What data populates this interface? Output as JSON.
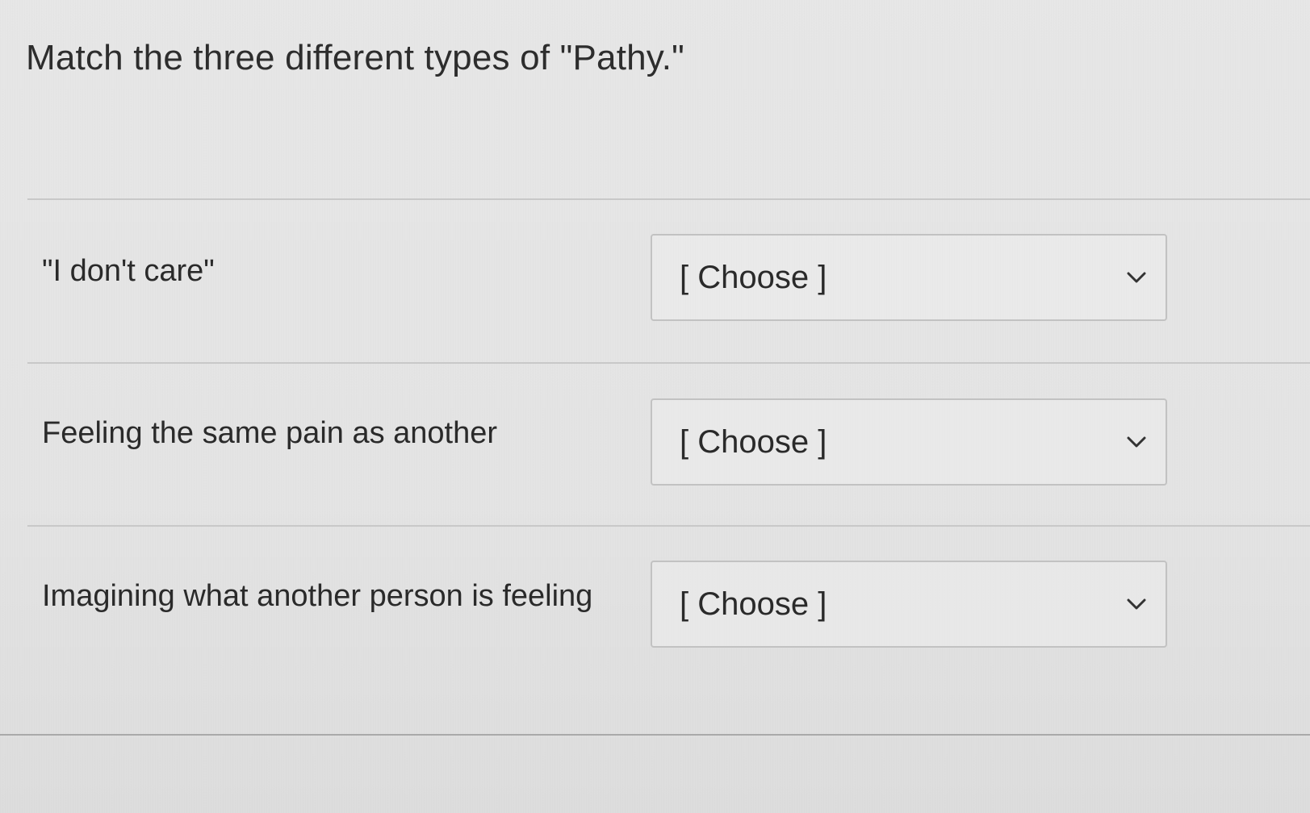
{
  "question": {
    "text": "Match the three different types of \"Pathy.\""
  },
  "matches": [
    {
      "prompt": "\"I don't care\"",
      "selected": "[ Choose ]"
    },
    {
      "prompt": "Feeling the same pain as another",
      "selected": "[ Choose ]"
    },
    {
      "prompt": "Imagining what another person is feeling",
      "selected": "[ Choose ]"
    }
  ],
  "icons": {
    "dropdown": "chevron-down-icon"
  },
  "colors": {
    "text": "#2a2a2a",
    "border": "#c2c2c2",
    "background": "#e4e4e4"
  }
}
